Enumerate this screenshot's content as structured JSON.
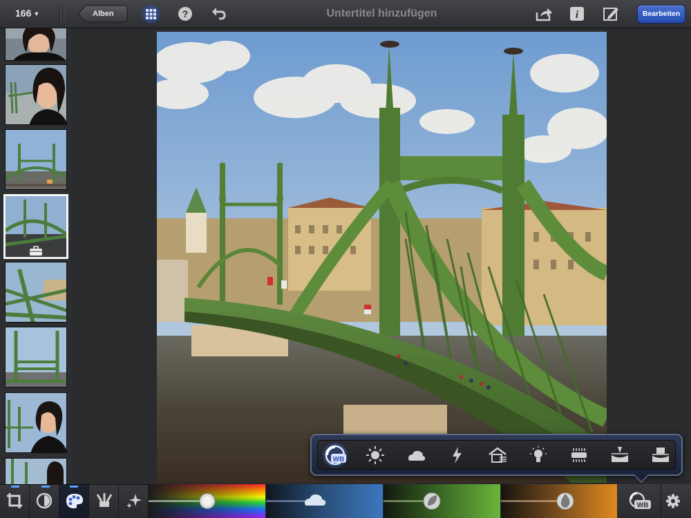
{
  "toolbar": {
    "photo_count": "166",
    "back_label": "Alben",
    "title_placeholder": "Untertitel hinzufügen",
    "edit_label": "Bearbeiten",
    "icons": [
      "grid-icon",
      "help-icon",
      "undo-icon",
      "share-icon",
      "info-icon",
      "edit-pen-icon"
    ]
  },
  "sidebar": {
    "thumbnails": [
      "woman-portrait",
      "woman-portrait",
      "bridge",
      "bridge-selected",
      "bridge",
      "bridge",
      "woman-portrait",
      "woman-portrait"
    ],
    "selected_index": 3
  },
  "adjust_popup": {
    "active_label": "WB",
    "icons": [
      "white-balance-icon",
      "sun-icon",
      "cloudy-icon",
      "flash-icon",
      "shade-icon",
      "incandescent-icon",
      "fluorescent-icon",
      "underwater-icon",
      "underwater-alt-icon"
    ]
  },
  "bottom": {
    "tools": [
      "crop-icon",
      "exposure-icon",
      "color-palette-icon",
      "brushes-icon",
      "effects-icon"
    ],
    "active_tool": "color-palette-icon",
    "sliders": [
      "saturation-slider",
      "blue-sky-slider",
      "greenery-slider",
      "skin-tone-slider"
    ],
    "wb_label": "WB",
    "settings": "gear-icon"
  },
  "colors": {
    "accent": "#3b63c9",
    "topbar": "#3a3b3f",
    "background": "#2a2b2d"
  }
}
